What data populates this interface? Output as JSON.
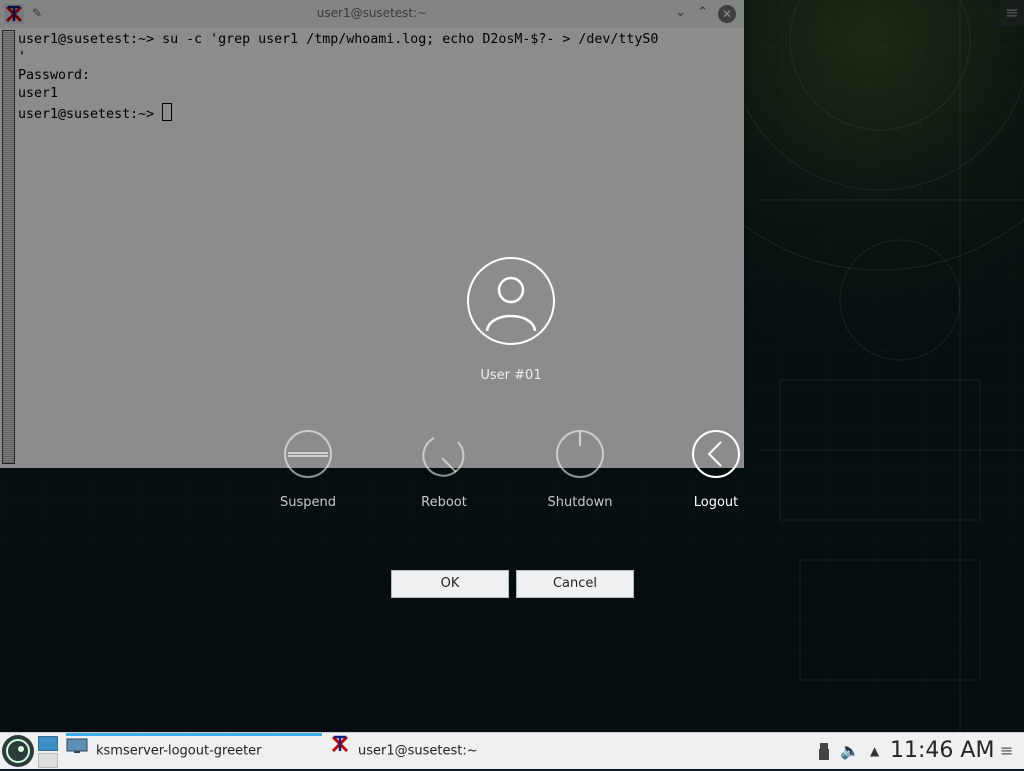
{
  "terminal": {
    "title": "user1@susetest:~",
    "lines": [
      "user1@susetest:~> su -c 'grep user1 /tmp/whoami.log; echo D2osM-$?- > /dev/ttyS0",
      "'",
      "Password:",
      "user1",
      "user1@susetest:~> "
    ]
  },
  "logout": {
    "user_name": "User #01",
    "actions": [
      {
        "label": "Suspend",
        "icon": "suspend-icon"
      },
      {
        "label": "Reboot",
        "icon": "reboot-icon"
      },
      {
        "label": "Shutdown",
        "icon": "shutdown-icon"
      },
      {
        "label": "Logout",
        "icon": "logout-icon",
        "selected": true
      }
    ],
    "ok_label": "OK",
    "cancel_label": "Cancel"
  },
  "taskbar": {
    "tasks": [
      {
        "label": "ksmserver-logout-greeter",
        "active": true
      },
      {
        "label": "user1@susetest:~",
        "active": false
      }
    ],
    "clock": "11:46 AM"
  },
  "colors": {
    "accent": "#3daee9",
    "taskbar_bg": "#eff0f1"
  }
}
